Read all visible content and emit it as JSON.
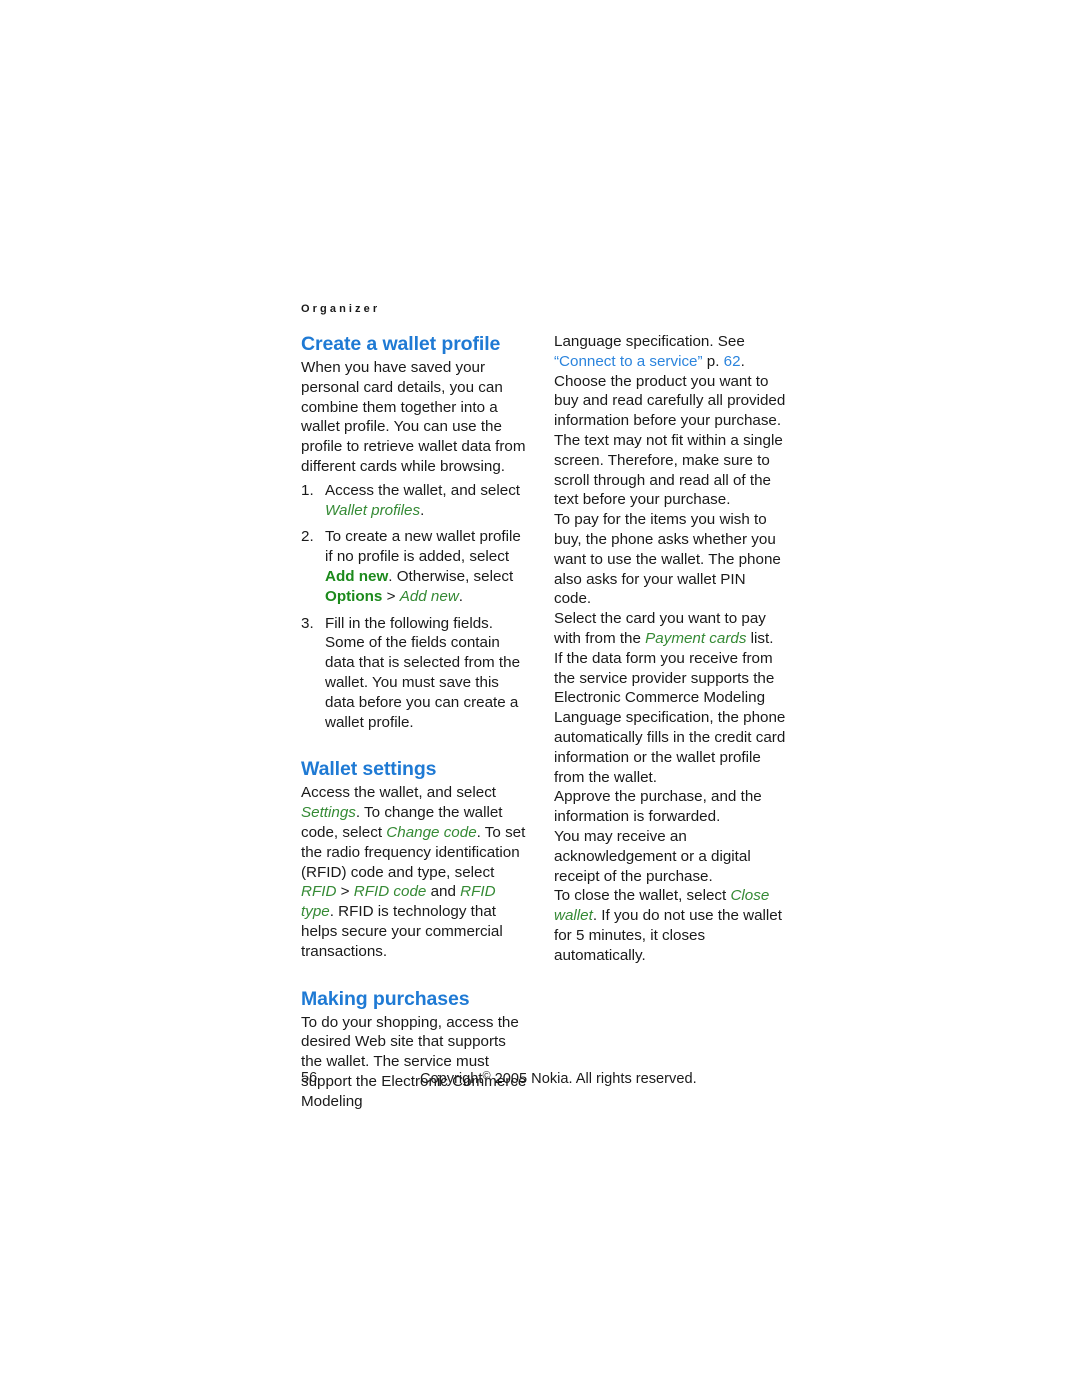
{
  "document": {
    "running_head": "Organizer",
    "page_number": "56",
    "copyright": {
      "prefix": "Copyright",
      "symbol": "©",
      "suffix": "2005 Nokia. All rights reserved."
    },
    "colors": {
      "heading_blue": "#1f7ad4",
      "link_blue": "#2b84dd",
      "ui_green_italic": "#358a35",
      "ui_green_bold": "#1c8a1c",
      "body_text": "#1a1a1a",
      "background": "#ffffff"
    }
  },
  "left_column": {
    "heading_1": "Create a wallet profile",
    "intro_paragraph": "When you have saved your personal card details, you can combine them together into a wallet profile. You can use the profile to retrieve wallet data from different cards while browsing.",
    "steps": [
      {
        "number": "1.",
        "parts": [
          {
            "text": "Access the wallet, and select ",
            "style": "plain"
          },
          {
            "text": "Wallet profiles",
            "style": "ui-italic"
          },
          {
            "text": ".",
            "style": "plain"
          }
        ]
      },
      {
        "number": "2.",
        "parts": [
          {
            "text": "To create a new wallet profile if no profile is added, select ",
            "style": "plain"
          },
          {
            "text": "Add new",
            "style": "ui-bold"
          },
          {
            "text": ". Otherwise, select ",
            "style": "plain"
          },
          {
            "text": "Options",
            "style": "ui-bold"
          },
          {
            "text": " > ",
            "style": "plain"
          },
          {
            "text": "Add new",
            "style": "ui-italic"
          },
          {
            "text": ".",
            "style": "plain"
          }
        ]
      },
      {
        "number": "3.",
        "parts": [
          {
            "text": "Fill in the following fields. Some of the fields contain data that is selected from the wallet. You must save this data before you can create a wallet profile.",
            "style": "plain"
          }
        ]
      }
    ],
    "heading_2": "Wallet settings",
    "wallet_settings_paragraph": [
      {
        "text": "Access the wallet, and select ",
        "style": "plain"
      },
      {
        "text": "Settings",
        "style": "ui-italic"
      },
      {
        "text": ". To change the wallet code, select ",
        "style": "plain"
      },
      {
        "text": "Change code",
        "style": "ui-italic"
      },
      {
        "text": ". To set the radio frequency identification (RFID) code and type, select ",
        "style": "plain"
      },
      {
        "text": "RFID",
        "style": "ui-italic"
      },
      {
        "text": " > ",
        "style": "plain"
      },
      {
        "text": "RFID code",
        "style": "ui-italic"
      },
      {
        "text": " and ",
        "style": "plain"
      },
      {
        "text": "RFID type",
        "style": "ui-italic"
      },
      {
        "text": ". RFID is technology that helps secure your commercial transactions.",
        "style": "plain"
      }
    ],
    "heading_3": "Making purchases",
    "making_purchases_paragraph": "To do your shopping, access the desired Web site that supports the wallet. The service must support the Electronic Commerce Modeling"
  },
  "right_column": {
    "continuation_paragraph": [
      {
        "text": "Language specification. See ",
        "style": "plain"
      },
      {
        "text": "“Connect to a service”",
        "style": "xref"
      },
      {
        "text": " p. ",
        "style": "plain"
      },
      {
        "text": "62",
        "style": "pagenum-ref"
      },
      {
        "text": ". Choose the product you want to buy and read carefully all provided information before your purchase. The text may not fit within a single screen. Therefore, make sure to scroll through and read all of the text before your purchase.",
        "style": "plain"
      }
    ],
    "paragraph_pay": "To pay for the items you wish to buy, the phone asks whether you want to use the wallet. The phone also asks for your wallet PIN code.",
    "paragraph_select_card": [
      {
        "text": "Select the card you want to pay with from the ",
        "style": "plain"
      },
      {
        "text": "Payment cards",
        "style": "ui-italic"
      },
      {
        "text": " list. If the data form you receive from the service provider supports the Electronic Commerce Modeling Language specification, the phone automatically fills in the credit card information or the wallet profile from the wallet.",
        "style": "plain"
      }
    ],
    "paragraph_approve": "Approve the purchase, and the information is forwarded.",
    "paragraph_receipt": "You may receive an acknowledgement or a digital receipt of the purchase.",
    "paragraph_close": [
      {
        "text": "To close the wallet, select ",
        "style": "plain"
      },
      {
        "text": "Close wallet",
        "style": "ui-italic"
      },
      {
        "text": ". If you do not use the wallet for 5 minutes, it closes automatically.",
        "style": "plain"
      }
    ]
  }
}
